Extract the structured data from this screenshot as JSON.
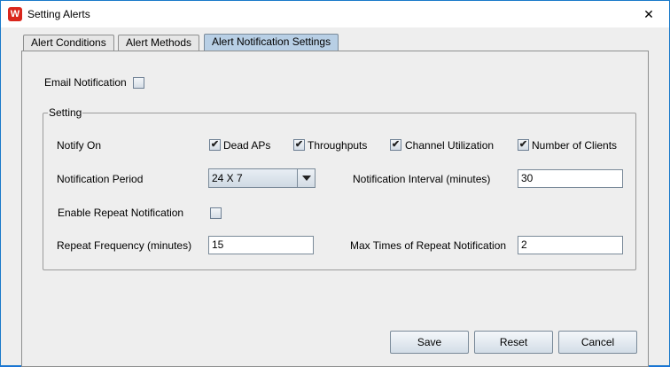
{
  "window": {
    "title": "Setting Alerts",
    "close_glyph": "✕",
    "icon": "app-logo-icon"
  },
  "tabs": [
    {
      "label": "Alert Conditions"
    },
    {
      "label": "Alert Methods"
    },
    {
      "label": "Alert Notification Settings",
      "active": true
    }
  ],
  "email": {
    "label": "Email Notification",
    "checked": false
  },
  "setting": {
    "title": "Setting",
    "notify_on": {
      "label": "Notify On",
      "options": [
        {
          "label": "Dead APs",
          "checked": true
        },
        {
          "label": "Throughputs",
          "checked": true
        },
        {
          "label": "Channel Utilization",
          "checked": true
        },
        {
          "label": "Number of Clients",
          "checked": true
        }
      ]
    },
    "notification_period": {
      "label": "Notification Period",
      "value": "24 X 7"
    },
    "notification_interval": {
      "label": "Notification Interval (minutes)",
      "value": "30"
    },
    "enable_repeat": {
      "label": "Enable Repeat Notification",
      "checked": false
    },
    "repeat_frequency": {
      "label": "Repeat Frequency (minutes)",
      "value": "15"
    },
    "max_times": {
      "label": "Max Times of Repeat Notification",
      "value": "2"
    }
  },
  "buttons": {
    "save": "Save",
    "reset": "Reset",
    "cancel": "Cancel"
  },
  "check_glyph": "✔"
}
